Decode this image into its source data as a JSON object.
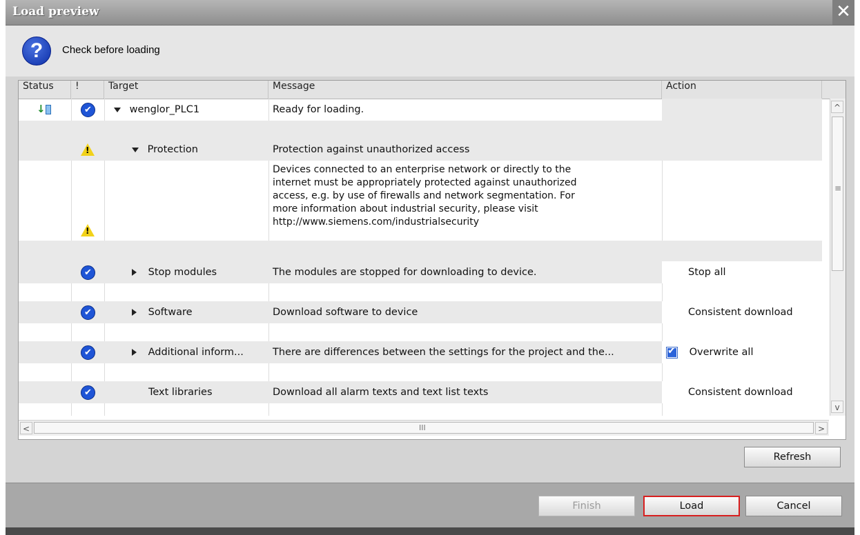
{
  "window": {
    "title": "Load preview",
    "close_label": "✕"
  },
  "header": {
    "text": "Check before loading",
    "icon": "question-icon"
  },
  "columns": [
    "Status",
    "!",
    "Target",
    "Message",
    "Action"
  ],
  "rows": [
    {
      "target": "wenglor_PLC1",
      "message": "Ready for loading.",
      "action": "",
      "expand": "down",
      "indent": 0
    },
    {
      "target": "Protection",
      "message": "Protection against unauthorized access",
      "action": "",
      "expand": "down",
      "indent": 1
    },
    {
      "message_lines": [
        "Devices connected to an enterprise network or directly to the",
        "internet must be appropriately protected against unauthorized",
        "access, e.g. by use of firewalls and network segmentation. For",
        "more information about industrial security, please visit",
        "http://www.siemens.com/industrialsecurity"
      ]
    },
    {
      "target": "Stop modules",
      "message": "The modules are stopped for downloading to device.",
      "action": "Stop all",
      "expand": "right",
      "indent": 1
    },
    {
      "target": "Software",
      "message": "Download software to device",
      "action": "Consistent download",
      "expand": "right",
      "indent": 1
    },
    {
      "target": "Additional inform...",
      "message": "There are differences between the settings for the project and the...",
      "action": "Overwrite all",
      "checked": true,
      "expand": "right",
      "indent": 1
    },
    {
      "target": "Text libraries",
      "message": "Download all alarm texts and text list texts",
      "action": "Consistent download",
      "expand": "none",
      "indent": 1
    }
  ],
  "scrollbar": {
    "h_grip": "III",
    "v_grip": "≡",
    "up": "^",
    "down": "v",
    "left": "<",
    "right": ">"
  },
  "buttons": {
    "refresh": "Refresh",
    "finish": "Finish",
    "load": "Load",
    "cancel": "Cancel"
  },
  "colors": {
    "accent_ok": "#1f55d6",
    "warning": "#f2d21a",
    "highlight": "#d81e1e"
  }
}
